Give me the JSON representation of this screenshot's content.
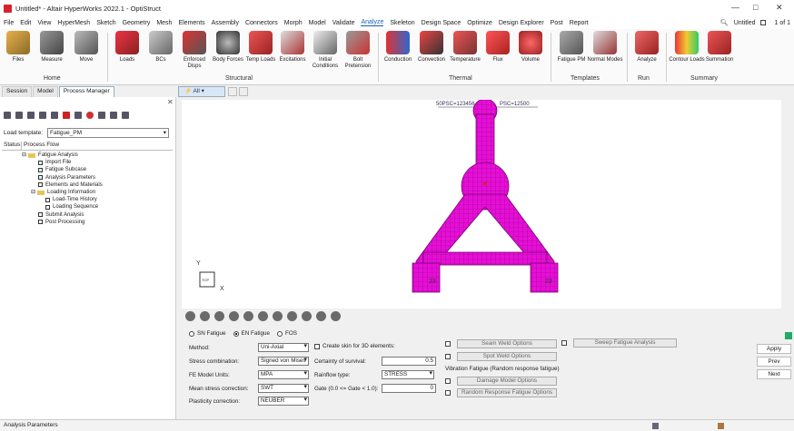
{
  "window": {
    "title": "Untitled* - Altair HyperWorks 2022.1 - OptiStruct",
    "minimize": "—",
    "maximize": "□",
    "close": "✕"
  },
  "menu": {
    "items": [
      "File",
      "Edit",
      "View",
      "HyperMesh",
      "Sketch",
      "Geometry",
      "Mesh",
      "Elements",
      "Assembly",
      "Connectors",
      "Morph",
      "Model",
      "Validate",
      "Analyze",
      "Skeleton",
      "Design Space",
      "Optimize",
      "Design Explorer",
      "Post",
      "Report"
    ],
    "active": "Analyze",
    "session_name": "Untitled",
    "page_indicator": "1 of 1"
  },
  "ribbon": {
    "home": {
      "label": "Home",
      "tools": [
        "Files",
        "Measure",
        "Move"
      ]
    },
    "structural": {
      "label": "Structural",
      "tools": [
        "Loads",
        "BCs",
        "Enforced Disps",
        "Body Forces",
        "Temp Loads",
        "Excitations",
        "Initial Conditions",
        "Bolt Pretension"
      ]
    },
    "thermal": {
      "label": "Thermal",
      "tools": [
        "Conduction",
        "Convection",
        "Temperature",
        "Flux",
        "Volume"
      ]
    },
    "templates": {
      "label": "Templates",
      "tools": [
        "Fatigue PM",
        "Normal Modes"
      ]
    },
    "run": {
      "label": "Run",
      "tools": [
        "Analyze"
      ]
    },
    "summary": {
      "label": "Summary",
      "tools": [
        "Contour Loads",
        "Summation"
      ]
    }
  },
  "left_tabs": [
    "Session",
    "Model",
    "Process Manager"
  ],
  "left_active_tab": "Process Manager",
  "process": {
    "load_template_label": "Load template:",
    "load_template_value": "Fatigue_PM",
    "col_status": "Status",
    "col_flow": "Process Flow",
    "tree": [
      {
        "label": "Fatigue Analysis",
        "level": 0,
        "type": "folder"
      },
      {
        "label": "Import File",
        "level": 1,
        "type": "checked"
      },
      {
        "label": "Fatigue Subcase",
        "level": 1,
        "type": "checked"
      },
      {
        "label": "Analysis Parameters",
        "level": 1,
        "type": "checked"
      },
      {
        "label": "Elements and Materials",
        "level": 1,
        "type": "box"
      },
      {
        "label": "Loading Information",
        "level": 1,
        "type": "folder"
      },
      {
        "label": "Load-Time History",
        "level": 2,
        "type": "box"
      },
      {
        "label": "Loading Sequence",
        "level": 2,
        "type": "box"
      },
      {
        "label": "Submit Analysis",
        "level": 1,
        "type": "box"
      },
      {
        "label": "Post Processing",
        "level": 1,
        "type": "box"
      }
    ]
  },
  "filter": {
    "label": "All"
  },
  "viewport": {
    "annotation_left": "23",
    "annotation_right": "23",
    "top_label_1": "50PSC=123456",
    "top_label_2": "PSC=12500",
    "axis_y": "Y",
    "axis_x": "X",
    "axis_top": "TOP"
  },
  "fatigue": {
    "modes": [
      "SN Fatigue",
      "EN Fatigue",
      "FOS"
    ],
    "selected_mode": "EN Fatigue",
    "method_label": "Method:",
    "method_value": "Uni-Axial",
    "stress_comb_label": "Stress combination:",
    "stress_comb_value": "Signed von Mises",
    "fe_units_label": "FE Model Units:",
    "fe_units_value": "MPA",
    "mean_stress_label": "Mean stress correction:",
    "mean_stress_value": "SWT",
    "plasticity_label": "Plasticity correction:",
    "plasticity_value": "NEUBER",
    "skin_label": "Create skin for 3D elements:",
    "certainty_label": "Certainty of survival:",
    "certainty_value": "0.5",
    "rainflow_label": "Rainflow type:",
    "rainflow_value": "STRESS",
    "gate_label": "Gate (0.0 <= Gate < 1.0):",
    "gate_value": "0",
    "seam_weld": "Seam Weld Options",
    "spot_weld": "Spot Weld Options",
    "vibration_label": "Vibration Fatigue (Random response fatigue)",
    "damage_model": "Damage Model Options",
    "random_response": "Random Response Fatigue Options",
    "sweep": "Sweep Fatigue Analysis"
  },
  "actions": {
    "apply": "Apply",
    "prev": "Prev",
    "next": "Next"
  },
  "status": {
    "text": "Analysis Parameters"
  },
  "colors": {
    "mesh": "#e60fd6",
    "mesh_line": "#7a0072",
    "accent": "#1a5fb4"
  }
}
